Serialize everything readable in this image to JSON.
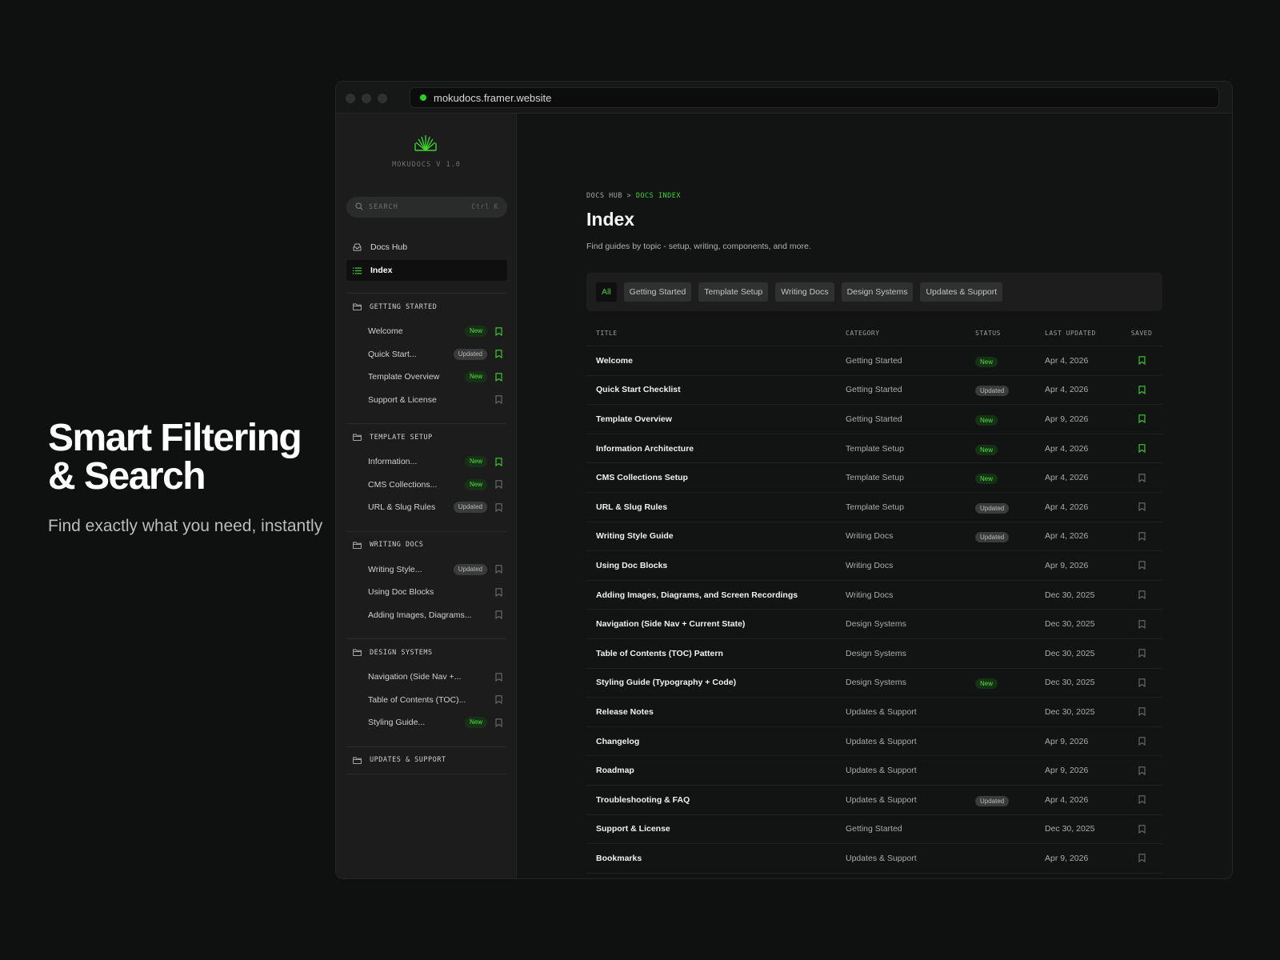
{
  "hero": {
    "title": "Smart Filtering & Search",
    "subtitle": "Find exactly what you need, instantly"
  },
  "browser": {
    "url": "mokudocs.framer.website"
  },
  "colors": {
    "accent": "#3ed12c",
    "background": "#0e110f"
  },
  "sidebar": {
    "version": "MOKUDOCS V 1.0",
    "search_placeholder": "SEARCH",
    "search_shortcut": "Ctrl K",
    "nav": [
      {
        "label": "Docs Hub",
        "icon": "inbox-icon",
        "active": false
      },
      {
        "label": "Index",
        "icon": "list-icon",
        "active": true
      }
    ],
    "groups": [
      {
        "label": "GETTING STARTED",
        "items": [
          {
            "label": "Welcome",
            "badge": "New",
            "saved": true
          },
          {
            "label": "Quick Start...",
            "badge": "Updated",
            "saved": true
          },
          {
            "label": "Template Overview",
            "badge": "New",
            "saved": true
          },
          {
            "label": "Support & License",
            "badge": "",
            "saved": false
          }
        ]
      },
      {
        "label": "TEMPLATE SETUP",
        "items": [
          {
            "label": "Information...",
            "badge": "New",
            "saved": true
          },
          {
            "label": "CMS Collections...",
            "badge": "New",
            "saved": false
          },
          {
            "label": "URL & Slug Rules",
            "badge": "Updated",
            "saved": false
          }
        ]
      },
      {
        "label": "WRITING DOCS",
        "items": [
          {
            "label": "Writing Style...",
            "badge": "Updated",
            "saved": false
          },
          {
            "label": "Using Doc Blocks",
            "badge": "",
            "saved": false
          },
          {
            "label": "Adding Images, Diagrams...",
            "badge": "",
            "saved": false
          }
        ]
      },
      {
        "label": "DESIGN SYSTEMS",
        "items": [
          {
            "label": "Navigation (Side Nav +...",
            "badge": "",
            "saved": false
          },
          {
            "label": "Table of Contents (TOC)...",
            "badge": "",
            "saved": false
          },
          {
            "label": "Styling Guide...",
            "badge": "New",
            "saved": false
          }
        ]
      },
      {
        "label": "UPDATES & SUPPORT",
        "items": []
      }
    ]
  },
  "main": {
    "breadcrumb": {
      "root": "DOCS HUB",
      "separator": ">",
      "current": "DOCS INDEX"
    },
    "title": "Index",
    "subtitle": "Find guides by topic - setup, writing, components, and more.",
    "filters": [
      {
        "label": "All",
        "active": true
      },
      {
        "label": "Getting Started",
        "active": false
      },
      {
        "label": "Template Setup",
        "active": false
      },
      {
        "label": "Writing Docs",
        "active": false
      },
      {
        "label": "Design Systems",
        "active": false
      },
      {
        "label": "Updates & Support",
        "active": false
      }
    ],
    "table": {
      "columns": [
        "TITLE",
        "CATEGORY",
        "STATUS",
        "LAST UPDATED",
        "SAVED"
      ],
      "rows": [
        {
          "title": "Welcome",
          "category": "Getting Started",
          "status": "New",
          "date": "Apr 4, 2026",
          "saved": true
        },
        {
          "title": "Quick Start Checklist",
          "category": "Getting Started",
          "status": "Updated",
          "date": "Apr 4, 2026",
          "saved": true
        },
        {
          "title": "Template Overview",
          "category": "Getting Started",
          "status": "New",
          "date": "Apr 9, 2026",
          "saved": true
        },
        {
          "title": "Information Architecture",
          "category": "Template Setup",
          "status": "New",
          "date": "Apr 4, 2026",
          "saved": true
        },
        {
          "title": "CMS Collections Setup",
          "category": "Template Setup",
          "status": "New",
          "date": "Apr 4, 2026",
          "saved": false
        },
        {
          "title": "URL & Slug Rules",
          "category": "Template Setup",
          "status": "Updated",
          "date": "Apr 4, 2026",
          "saved": false
        },
        {
          "title": "Writing Style Guide",
          "category": "Writing Docs",
          "status": "Updated",
          "date": "Apr 4, 2026",
          "saved": false
        },
        {
          "title": "Using Doc Blocks",
          "category": "Writing Docs",
          "status": "",
          "date": "Apr 9, 2026",
          "saved": false
        },
        {
          "title": "Adding Images, Diagrams, and Screen Recordings",
          "category": "Writing Docs",
          "status": "",
          "date": "Dec 30, 2025",
          "saved": false
        },
        {
          "title": "Navigation (Side Nav + Current State)",
          "category": "Design Systems",
          "status": "",
          "date": "Dec 30, 2025",
          "saved": false
        },
        {
          "title": "Table of Contents (TOC) Pattern",
          "category": "Design Systems",
          "status": "",
          "date": "Dec 30, 2025",
          "saved": false
        },
        {
          "title": "Styling Guide (Typography + Code)",
          "category": "Design Systems",
          "status": "New",
          "date": "Dec 30, 2025",
          "saved": false
        },
        {
          "title": "Release Notes",
          "category": "Updates & Support",
          "status": "",
          "date": "Dec 30, 2025",
          "saved": false
        },
        {
          "title": "Changelog",
          "category": "Updates & Support",
          "status": "",
          "date": "Apr 9, 2026",
          "saved": false
        },
        {
          "title": "Roadmap",
          "category": "Updates & Support",
          "status": "",
          "date": "Apr 9, 2026",
          "saved": false
        },
        {
          "title": "Troubleshooting & FAQ",
          "category": "Updates & Support",
          "status": "Updated",
          "date": "Apr 4, 2026",
          "saved": false
        },
        {
          "title": "Support & License",
          "category": "Getting Started",
          "status": "",
          "date": "Dec 30, 2025",
          "saved": false
        },
        {
          "title": "Bookmarks",
          "category": "Updates & Support",
          "status": "",
          "date": "Apr 9, 2026",
          "saved": false
        }
      ]
    }
  }
}
